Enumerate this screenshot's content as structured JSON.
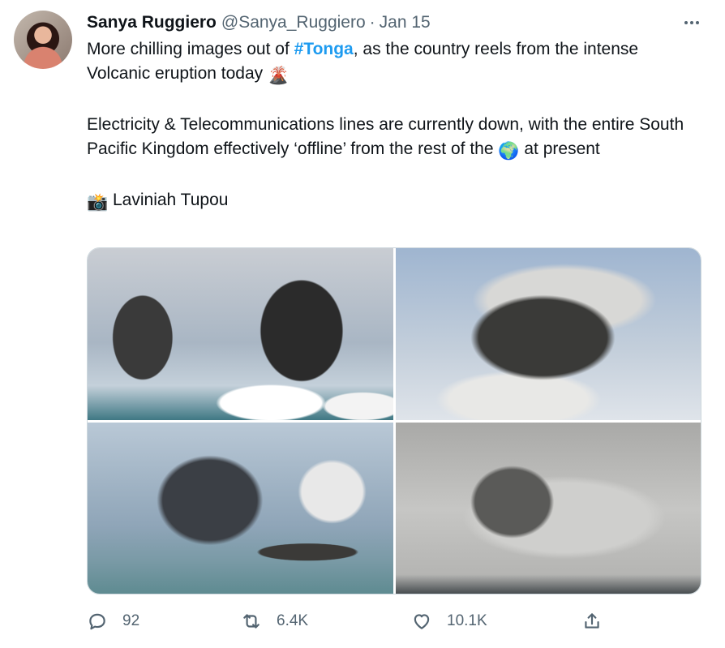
{
  "author": {
    "name": "Sanya Ruggiero",
    "handle": "@Sanya_Ruggiero",
    "separator": "·",
    "date": "Jan 15"
  },
  "tweet": {
    "line1_prefix": "More chilling images out of ",
    "hashtag": "#Tonga",
    "line1_suffix": ", as the country reels from the intense Volcanic eruption today",
    "volcano_emoji": "🌋",
    "para2_prefix": "Electricity & Telecommunications lines are currently down, with the entire South Pacific Kingdom effectively ‘offline’ from the rest of the",
    "globe_emoji": "🌍",
    "para2_suffix": "at present",
    "camera_emoji": "📸",
    "credit": "Laviniah Tupou"
  },
  "media": {
    "photos": [
      "volcanic-eruption-photo-1",
      "volcanic-eruption-photo-2",
      "volcanic-eruption-photo-3",
      "volcanic-eruption-photo-4"
    ]
  },
  "actions": {
    "replies": "92",
    "retweets": "6.4K",
    "likes": "10.1K"
  },
  "icons": {
    "reply": "reply-icon",
    "retweet": "retweet-icon",
    "like": "heart-icon",
    "share": "share-icon",
    "more": "more-options-icon"
  },
  "colors": {
    "link": "#1d9bf0",
    "secondary_text": "#536471",
    "primary_text": "#0f1419"
  }
}
